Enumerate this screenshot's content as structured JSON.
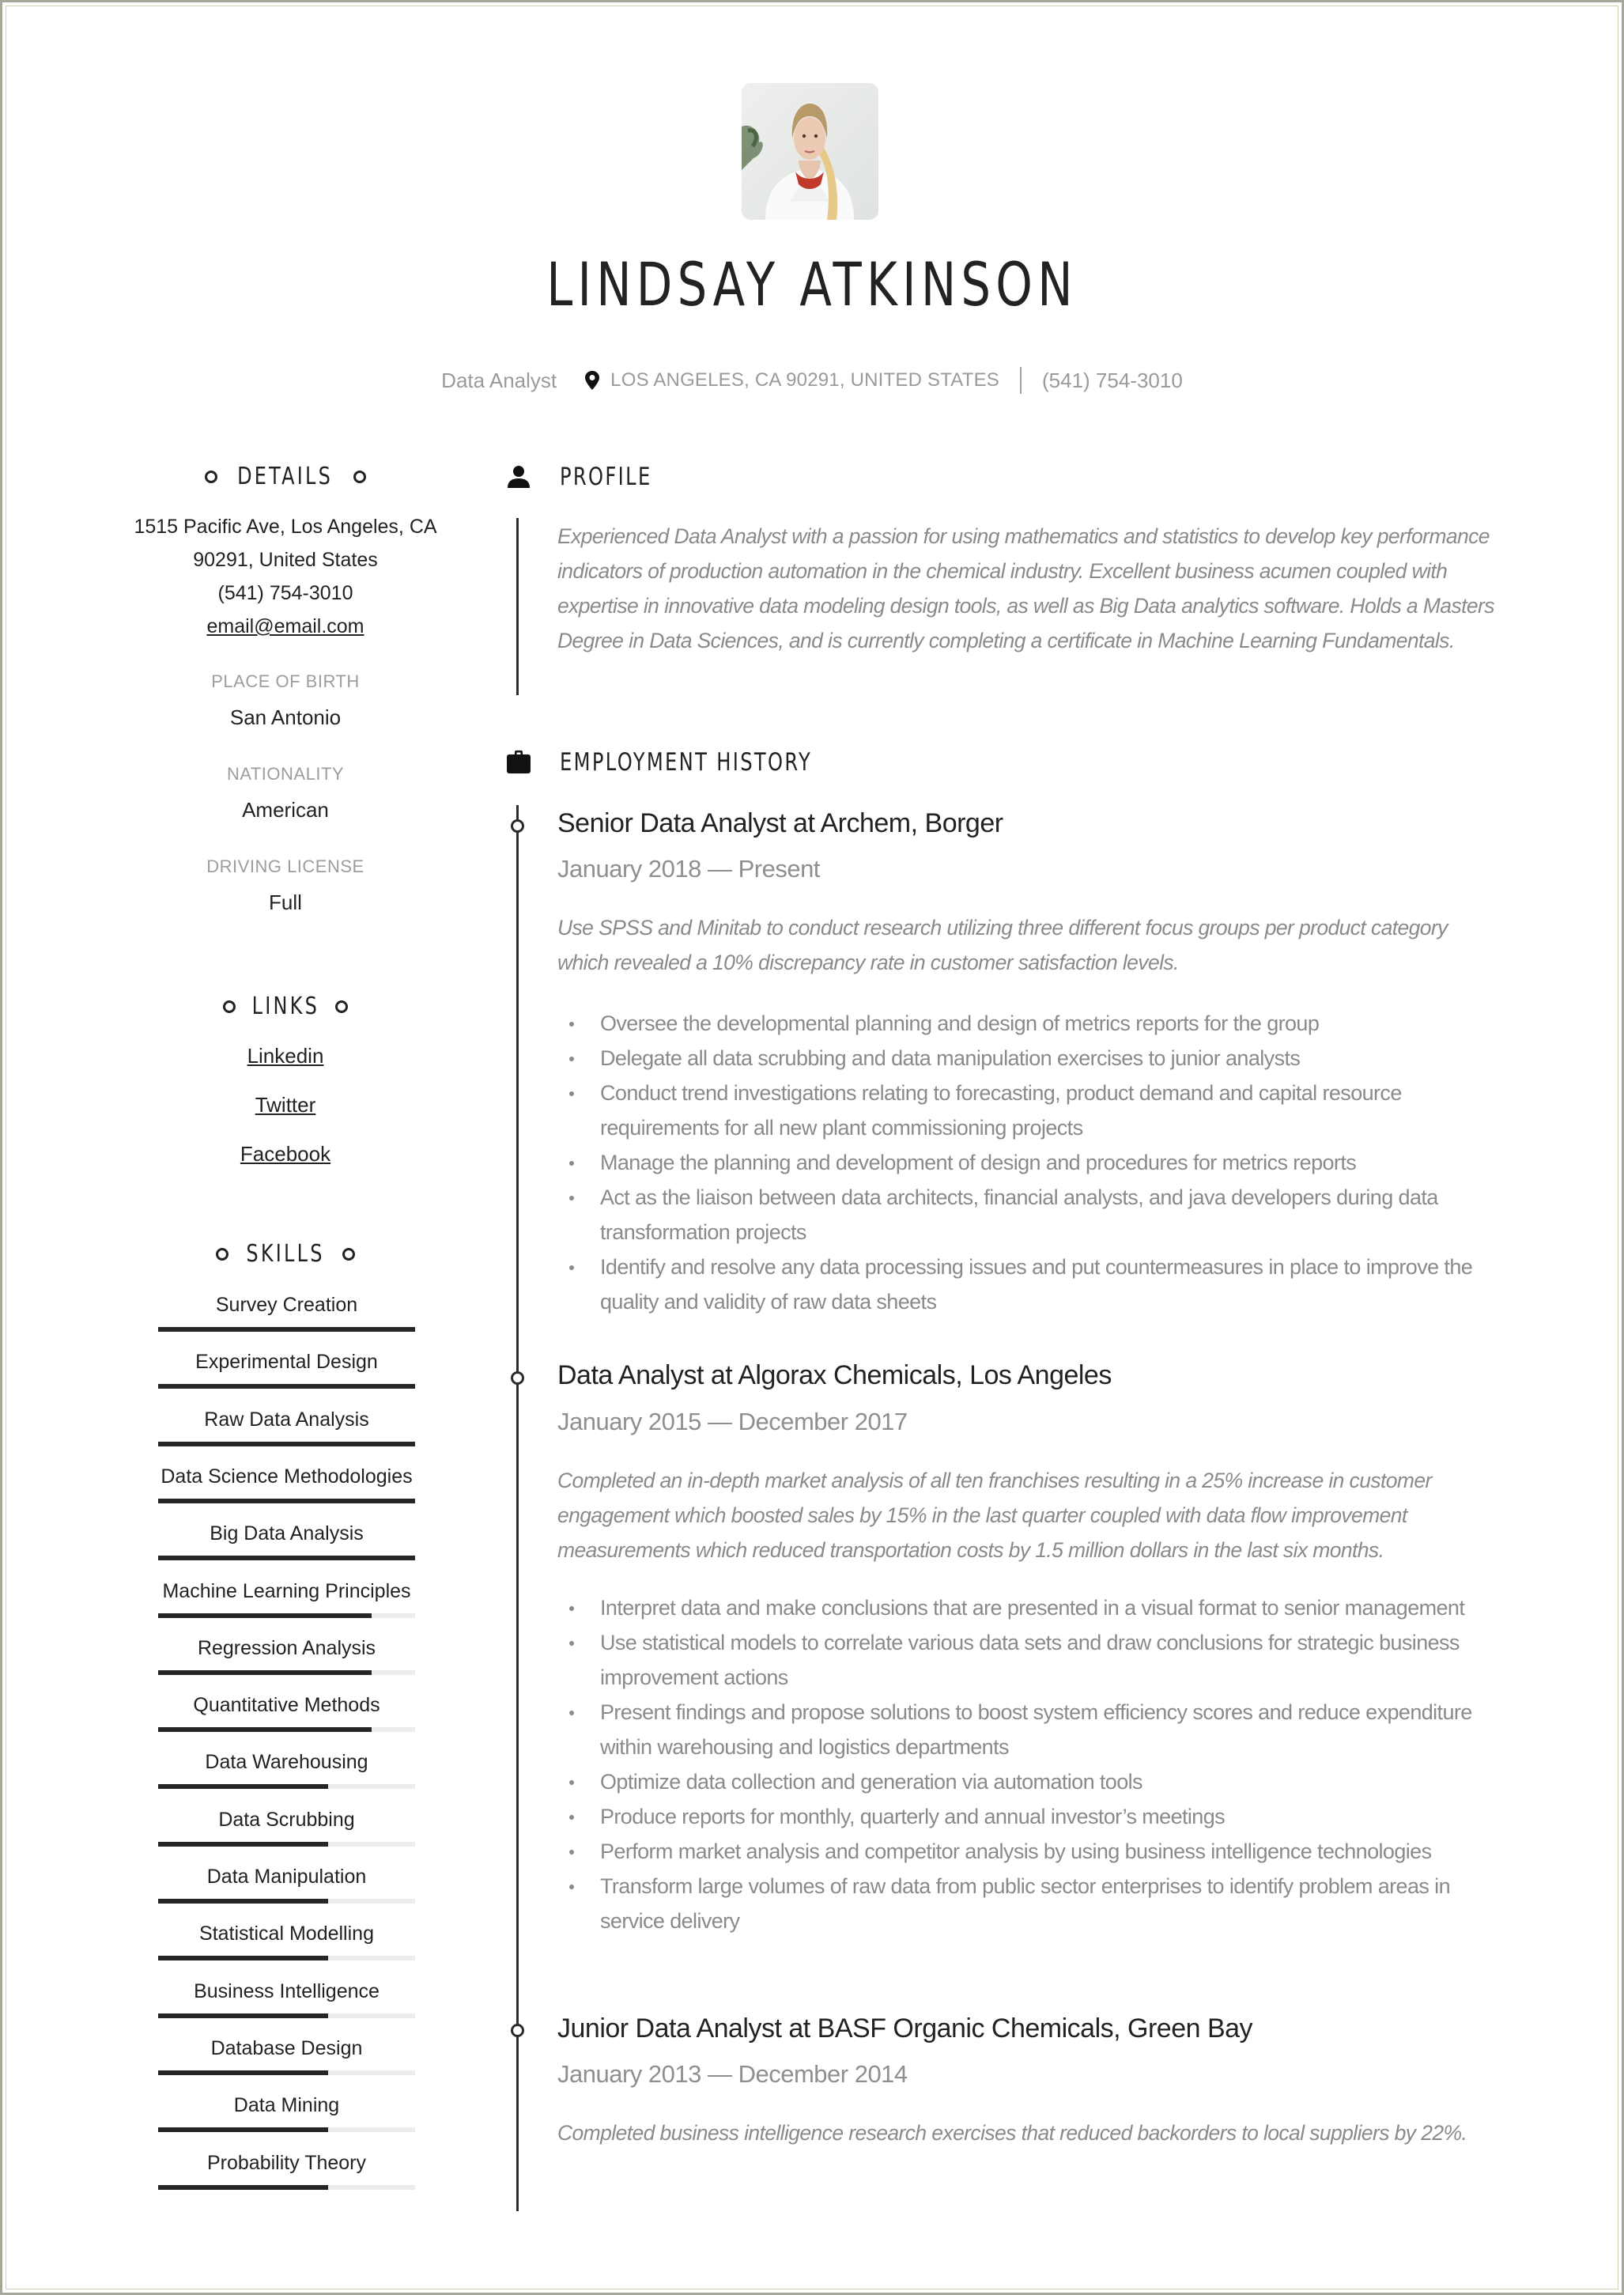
{
  "header": {
    "name": "LINDSAY ATKINSON",
    "job_title": "Data Analyst",
    "location": "LOS ANGELES, CA 90291, UNITED STATES",
    "phone": "(541) 754-3010",
    "photo_alt": "Profile photo of Lindsay Atkinson"
  },
  "details": {
    "heading": "DETAILS",
    "address_line1": "1515 Pacific Ave, Los Angeles, CA",
    "address_line2": "90291, United States",
    "phone": "(541) 754-3010",
    "email": "email@email.com",
    "fields": [
      {
        "label": "PLACE OF BIRTH",
        "value": "San Antonio"
      },
      {
        "label": "NATIONALITY",
        "value": "American"
      },
      {
        "label": "DRIVING LICENSE",
        "value": "Full"
      }
    ]
  },
  "links": {
    "heading": "LINKS",
    "items": [
      "Linkedin",
      "Twitter",
      "Facebook"
    ]
  },
  "skills": {
    "heading": "SKILLS",
    "items": [
      {
        "name": "Survey Creation",
        "level": 1.0
      },
      {
        "name": "Experimental Design",
        "level": 1.0
      },
      {
        "name": "Raw Data Analysis",
        "level": 1.0
      },
      {
        "name": "Data Science Methodologies",
        "level": 1.0
      },
      {
        "name": "Big Data Analysis",
        "level": 1.0
      },
      {
        "name": "Machine Learning Principles",
        "level": 0.83
      },
      {
        "name": "Regression Analysis",
        "level": 0.83
      },
      {
        "name": "Quantitative Methods",
        "level": 0.83
      },
      {
        "name": "Data Warehousing",
        "level": 0.66
      },
      {
        "name": "Data Scrubbing",
        "level": 0.66
      },
      {
        "name": "Data Manipulation",
        "level": 0.66
      },
      {
        "name": "Statistical Modelling",
        "level": 0.66
      },
      {
        "name": "Business Intelligence",
        "level": 0.66
      },
      {
        "name": "Database Design",
        "level": 0.66
      },
      {
        "name": "Data Mining",
        "level": 0.66
      },
      {
        "name": "Probability Theory",
        "level": 0.66
      }
    ]
  },
  "profile": {
    "heading": "PROFILE",
    "text": "Experienced Data Analyst with a passion for using mathematics and statistics to develop key performance indicators of production automation in the chemical industry.  Excellent business acumen coupled with expertise in innovative data modeling design tools, as well as Big Data analytics software.  Holds a Masters Degree in Data Sciences, and is currently completing a certificate in Machine Learning Fundamentals."
  },
  "employment": {
    "heading": "EMPLOYMENT HISTORY",
    "jobs": [
      {
        "title": "Senior Data Analyst at  Archem, Borger",
        "dates": "January 2018 — Present",
        "description": "Use SPSS and Minitab to conduct research utilizing three different focus groups per product category which revealed a 10% discrepancy rate in customer satisfaction levels.",
        "bullets": [
          "Oversee the developmental planning and design of metrics reports for the group",
          "Delegate all data scrubbing and data manipulation exercises to junior analysts",
          "Conduct trend investigations relating to forecasting, product demand and capital resource requirements for all new plant commissioning projects",
          "Manage the planning and development of design and procedures for metrics reports",
          "Act as the liaison between data architects, financial analysts, and java developers during data transformation projects",
          "Identify and resolve any data processing issues and put countermeasures in place to improve the quality and validity of raw data sheets"
        ]
      },
      {
        "title": "Data Analyst at  Algorax Chemicals, Los Angeles",
        "dates": "January 2015 — December 2017",
        "description": "Completed an in-depth market analysis of all ten franchises resulting in a 25% increase in customer engagement which boosted sales by 15% in the last quarter coupled with data flow improvement measurements which reduced transportation costs by 1.5 million dollars in the last six months.",
        "bullets": [
          "Interpret data and make conclusions that are presented in a visual format to senior management",
          "Use statistical models to correlate various data sets and draw conclusions for strategic business improvement actions",
          "Present findings and propose solutions to boost system efficiency scores and reduce expenditure within warehousing and logistics departments",
          "Optimize data collection and generation via automation tools",
          "Produce reports for monthly, quarterly and annual investor’s meetings",
          "Perform market analysis and competitor analysis by using business intelligence technologies",
          "Transform large volumes of raw data from public sector enterprises to identify problem areas in service delivery"
        ]
      },
      {
        "title": "Junior Data Analyst at  BASF Organic Chemicals, Green Bay",
        "dates": "January 2013 — December 2014",
        "description": "Completed business intelligence research exercises that reduced backorders to local suppliers by 22%.",
        "bullets": []
      }
    ]
  }
}
